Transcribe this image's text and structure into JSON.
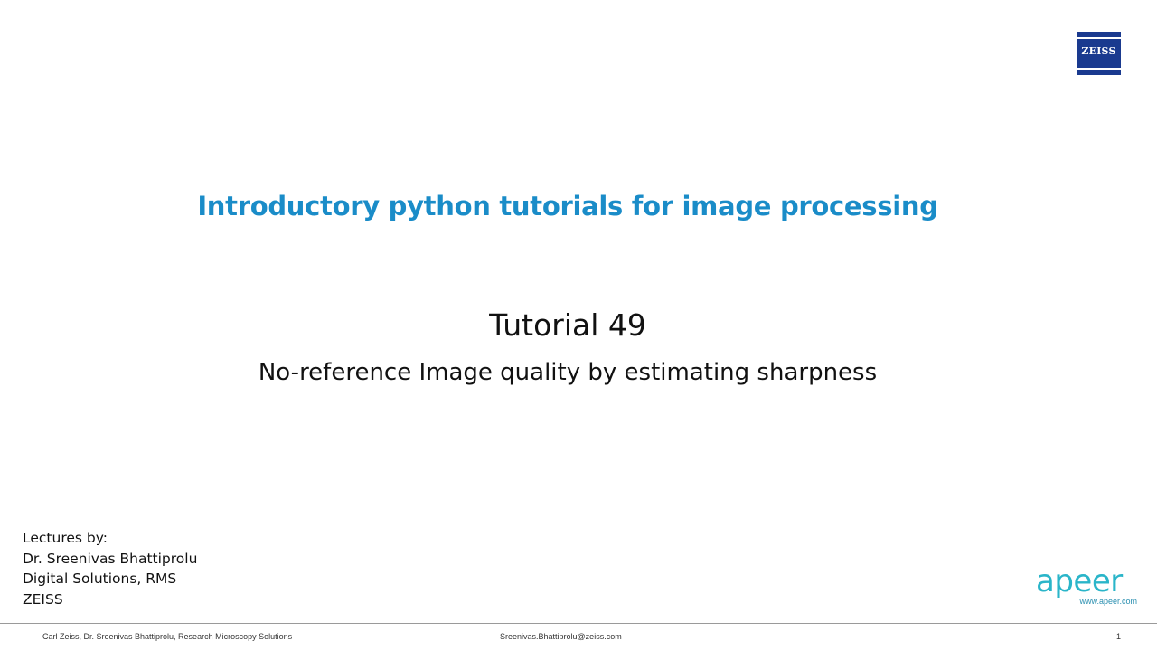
{
  "header": {
    "logo_text": "ZEISS"
  },
  "main": {
    "course_title": "Introductory python tutorials for image processing",
    "tutorial_number": "Tutorial 49",
    "tutorial_subtitle": "No-reference Image quality by estimating sharpness"
  },
  "lecturer": {
    "lines": [
      "Lectures by:",
      "Dr. Sreenivas Bhattiprolu",
      "Digital Solutions, RMS",
      "ZEISS"
    ]
  },
  "brand": {
    "apeer_word": "apeer",
    "apeer_url": "www.apeer.com"
  },
  "footer": {
    "left_text": "Carl Zeiss, Dr. Sreenivas Bhattiprolu, Research Microscopy Solutions",
    "center_text": "Sreenivas.Bhattiprolu@zeiss.com",
    "page_number": "1"
  },
  "colors": {
    "title_blue": "#1a8cc8",
    "zeiss_navy": "#1a3a8f",
    "apeer_teal": "#2ab5c9"
  }
}
